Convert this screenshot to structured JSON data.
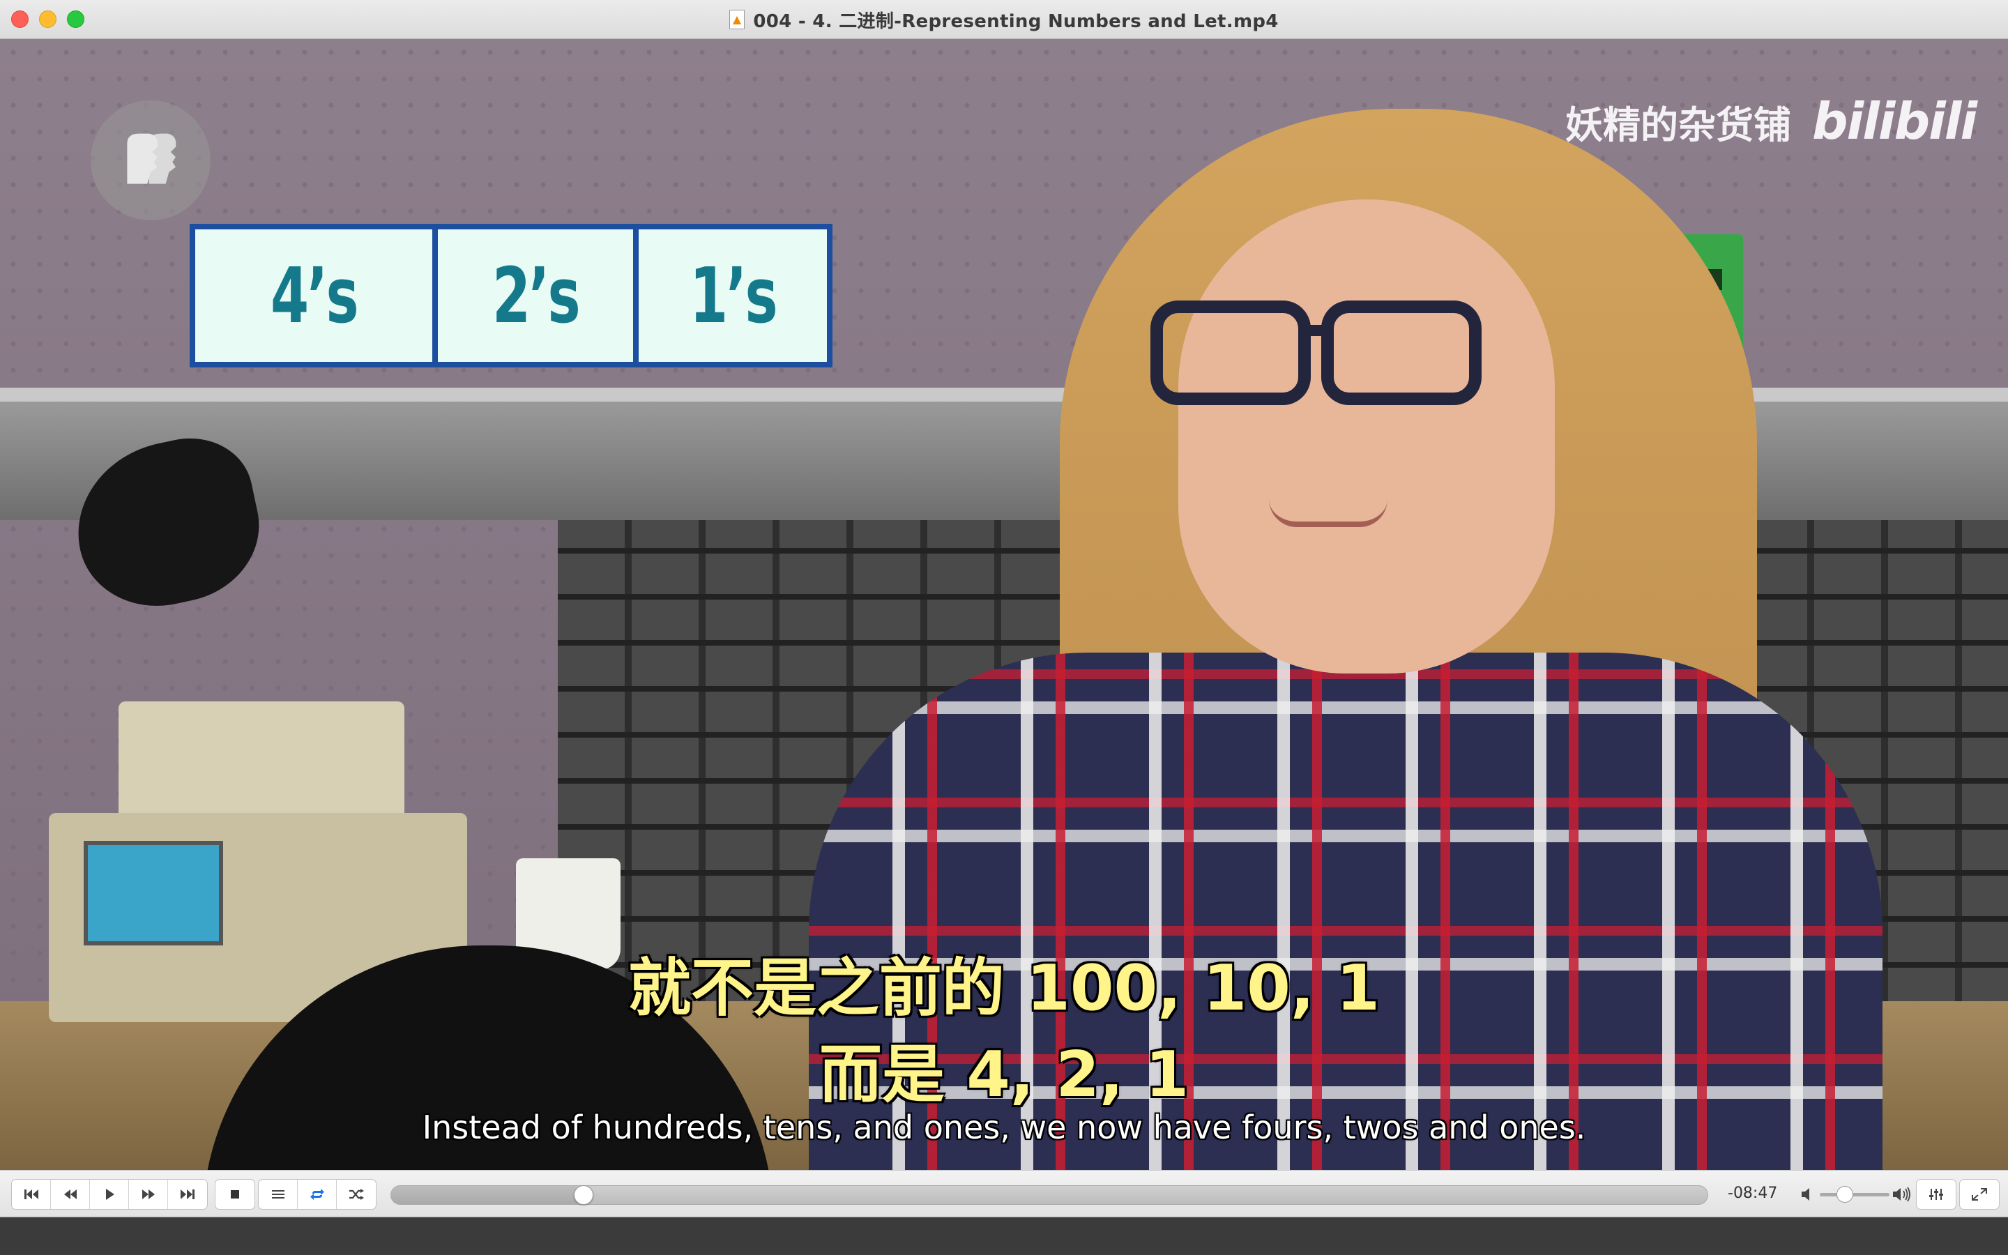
{
  "window": {
    "title": "004 - 4. 二进制-Representing Numbers and Let.mp4"
  },
  "video": {
    "watermark_cn": "妖精的杂货铺",
    "watermark_brand": "bilibili",
    "place_values": [
      "4’s",
      "2’s",
      "1’s"
    ],
    "subtitle_cn_line1": "就不是之前的 100, 10, 1",
    "subtitle_cn_line2": "而是 4, 2, 1",
    "subtitle_en": "Instead of hundreds, tens, and ones, we now have fours, twos and ones."
  },
  "controls": {
    "time_remaining": "-08:47",
    "seek_progress": 0.146,
    "volume_level": 0.36,
    "icons": {
      "previous": "skip-previous-icon",
      "rewind": "rewind-icon",
      "play": "play-icon",
      "forward": "fast-forward-icon",
      "next": "skip-next-icon",
      "stop": "stop-icon",
      "playlist": "playlist-icon",
      "loop": "loop-icon",
      "shuffle": "shuffle-icon",
      "volume_low": "volume-low-icon",
      "volume_high": "volume-high-icon",
      "equalizer": "equalizer-icon",
      "fullscreen": "fullscreen-icon"
    },
    "accent_color": "#1a73e8"
  }
}
